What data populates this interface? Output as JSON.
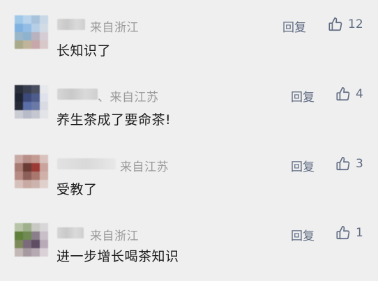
{
  "comments": [
    {
      "location": "来自浙江",
      "reply_label": "回复",
      "likes": "12",
      "text": "长知识了"
    },
    {
      "location": "、来自江苏",
      "reply_label": "回复",
      "likes": "4",
      "text": "养生茶成了要命茶!"
    },
    {
      "location": "来自江苏",
      "reply_label": "回复",
      "likes": "3",
      "text": "受教了"
    },
    {
      "location": "来自浙江",
      "reply_label": "回复",
      "likes": "1",
      "text": "进一步增长喝茶知识"
    }
  ],
  "icons": {
    "like": "thumbs-up-icon"
  },
  "colors": {
    "background": "#efefef",
    "link": "#5f6b82",
    "text": "#1a1a1a",
    "muted": "#9a9a9a"
  }
}
